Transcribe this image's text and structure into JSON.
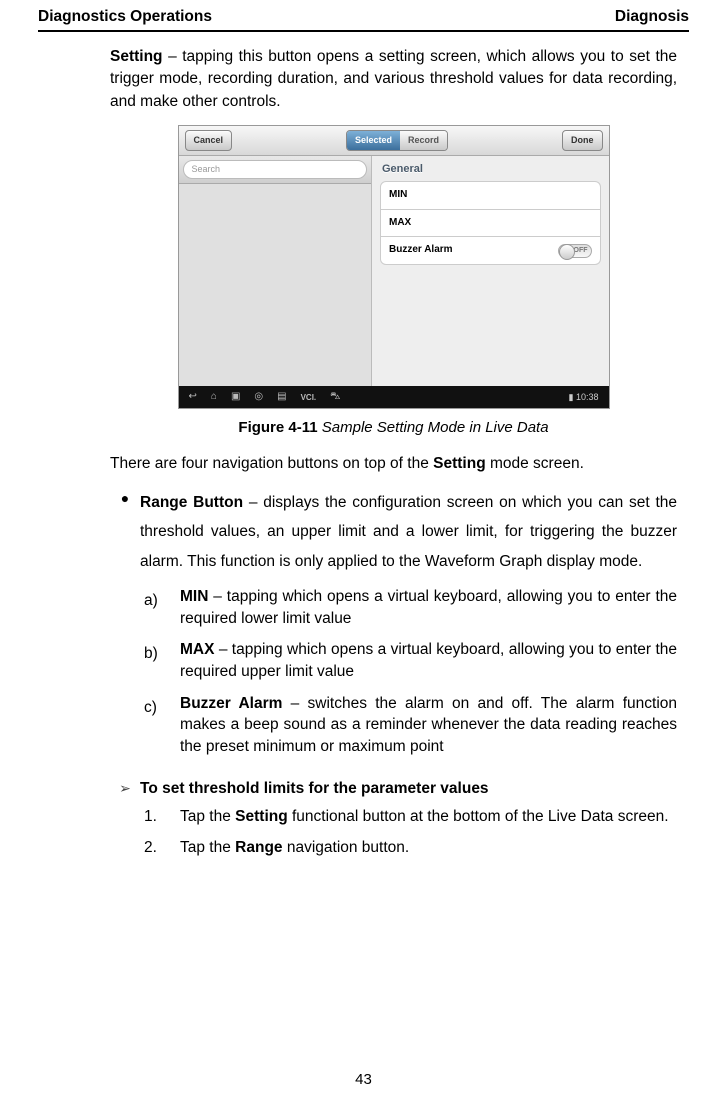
{
  "header": {
    "left": "Diagnostics Operations",
    "right": "Diagnosis"
  },
  "intro": {
    "bold": "Setting",
    "rest": " – tapping this button opens a setting screen, which allows you to set the trigger mode, recording duration, and various threshold values for data recording, and make other controls."
  },
  "figure": {
    "cancel": "Cancel",
    "seg_selected": "Selected",
    "seg_record": "Record",
    "done": "Done",
    "search_placeholder": "Search",
    "group_header": "General",
    "rows": {
      "min": "MIN",
      "max": "MAX",
      "buzzer": "Buzzer Alarm"
    },
    "toggle_text": "OFF",
    "time": "10:38",
    "label": "Figure 4-11",
    "title": " Sample Setting Mode in Live Data"
  },
  "after_fig": {
    "pre": "There are four navigation buttons on top of the ",
    "bold": "Setting",
    "post": " mode screen."
  },
  "range_bullet": {
    "bold": "Range Button",
    "text_a": " – displays the configuration screen on which you can set the threshold values, an upper limit and a lower limit, for triggering the buzzer alarm",
    "text_b": ". This function is only applied to the Waveform Graph display mode."
  },
  "subs": {
    "a_mark": "a)",
    "a_bold": "MIN",
    "a_text": " – tapping which opens a virtual keyboard, allowing you to enter the required lower limit value",
    "b_mark": "b)",
    "b_bold": "MAX",
    "b_text": " – tapping which opens a virtual keyboard, allowing you to enter the required upper limit value",
    "c_mark": "c)",
    "c_bold": "Buzzer Alarm",
    "c_text": " – switches the alarm on and off. The alarm function makes a beep sound as a reminder whenever the data reading reaches the preset minimum or maximum point"
  },
  "arrow_heading": "To set threshold limits for the parameter values",
  "steps": {
    "s1_mark": "1.",
    "s1_pre": "Tap the ",
    "s1_bold": "Setting",
    "s1_post": " functional button at the bottom of the Live Data screen.",
    "s2_mark": "2.",
    "s2_pre": "Tap the ",
    "s2_bold": "Range",
    "s2_post": " navigation button."
  },
  "pagenum": "43"
}
